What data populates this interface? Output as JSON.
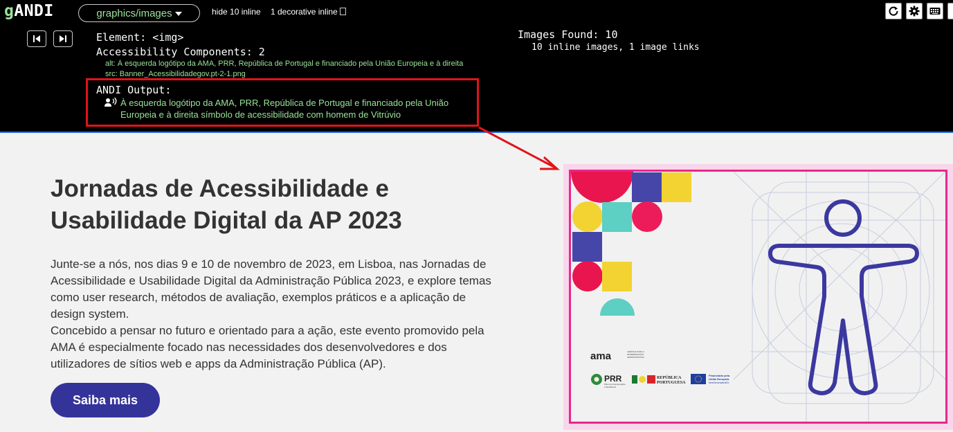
{
  "andi": {
    "logo_prefix": "g",
    "logo_main": "ANDI",
    "module": "graphics/images",
    "hide_inline": "hide 10 inline",
    "decorative_inline": "1 decorative inline",
    "element": "Element: <img>",
    "components": "Accessibility Components: 2",
    "alt_line": "alt: À esquerda logótipo da AMA, PRR, República de Portugal e financiado pela União Europeia e à direita",
    "src_line": "src: Banner_Acessibilidadegov.pt-2-1.png",
    "images_found": "Images Found: 10",
    "images_sub": "10 inline images, 1 image links",
    "output_title": "ANDI Output:",
    "output_text": "À esquerda logótipo da AMA, PRR, República de Portugal e financiado pela União Europeia e à direita símbolo de acessibilidade com homem de Vitrúvio"
  },
  "page": {
    "title": "Jornadas de Acessibilidade e Usabilidade Digital da AP 2023",
    "description_1": "Junte-se a nós, nos dias 9 e 10 de novembro de 2023, em Lisboa, nas Jornadas de Acessibilidade e Usabilidade Digital da Administração Pública 2023, e explore temas como user research, métodos de avaliação, exemplos práticos e a aplicação de design system.",
    "description_2": "Concebido a pensar no futuro e orientado para a ação, este evento promovido pela AMA é especialmente focado nas necessidades dos desenvolvedores e dos utilizadores de sítios web e apps da Administração Pública (AP).",
    "button": "Saiba mais"
  },
  "banner": {
    "ama": "ama",
    "ama_sub_1": "AGÊNCIA PARA A",
    "ama_sub_2": "MODERNIZAÇÃO",
    "ama_sub_3": "ADMINISTRATIVA",
    "prr": "PRR",
    "prr_sub_1": "Plano de Recuperação",
    "prr_sub_2": "e Resiliência",
    "rp_1": "REPÚBLICA",
    "rp_2": "PORTUGUESA",
    "eu_1": "Financiado pela",
    "eu_2": "União Europeia",
    "eu_3": "NextGenerationEU"
  },
  "colors": {
    "highlight": "#e0141a",
    "andi_green": "#9be39b",
    "button": "#34339a",
    "banner_border": "#e8278e",
    "figure": "#3b38a0"
  },
  "icons": [
    "refresh-icon",
    "gear-icon",
    "keyboard-icon",
    "prev-element-icon",
    "next-element-icon",
    "screen-reader-icon",
    "arrow-icon"
  ]
}
